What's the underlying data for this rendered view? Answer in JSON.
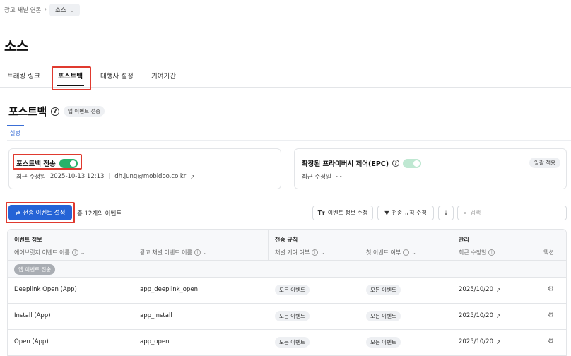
{
  "breadcrumb": {
    "parent": "광고 채널 연동",
    "current": "소스"
  },
  "page": {
    "title": "소스"
  },
  "tabs": [
    {
      "label": "트래킹 링크"
    },
    {
      "label": "포스트백"
    },
    {
      "label": "대행사 설정"
    },
    {
      "label": "기여기간"
    }
  ],
  "section": {
    "title": "포스트백",
    "badge": "앱 이벤트 전송",
    "subtab": "설정"
  },
  "cards": {
    "postback": {
      "title": "포스트백 전송",
      "modified_label": "최근 수정일",
      "modified_value": "2025-10-13 12:13",
      "modified_by": "dh.jung@mobidoo.co.kr"
    },
    "epc": {
      "title": "확장된 프라이버시 제어(EPC)",
      "modified_label": "최근 수정일",
      "modified_value": "- -",
      "pill": "일괄 적용"
    }
  },
  "toolbar": {
    "primary": "전송 이벤트 설정",
    "total": "총 12개의 이벤트",
    "edit_info": "이벤트 정보 수정",
    "edit_rule": "전송 규칙 수정",
    "search_placeholder": "검색"
  },
  "table": {
    "groups": {
      "event_info": "이벤트 정보",
      "rule": "전송 규칙",
      "manage": "관리"
    },
    "columns": {
      "airbridge": "에어브릿지 이벤트 이름",
      "channel": "광고 채널 이벤트 이름",
      "contribution": "채널 기여 여부",
      "first": "첫 이벤트 여부",
      "modified": "최근 수정일",
      "action": "액션"
    },
    "group_label": "앱 이벤트 전송",
    "rows": [
      {
        "airbridge": "Deeplink Open (App)",
        "channel": "app_deeplink_open",
        "contribution": "모든 이벤트",
        "first": "모든 이벤트",
        "modified": "2025/10/20"
      },
      {
        "airbridge": "Install (App)",
        "channel": "app_install",
        "contribution": "모든 이벤트",
        "first": "모든 이벤트",
        "modified": "2025/10/20"
      },
      {
        "airbridge": "Open (App)",
        "channel": "app_open",
        "contribution": "모든 이벤트",
        "first": "모든 이벤트",
        "modified": "2025/10/20"
      }
    ]
  },
  "colors": {
    "primary": "#2563d6",
    "toggle_on": "#27b36a",
    "highlight": "#e03a2f"
  }
}
